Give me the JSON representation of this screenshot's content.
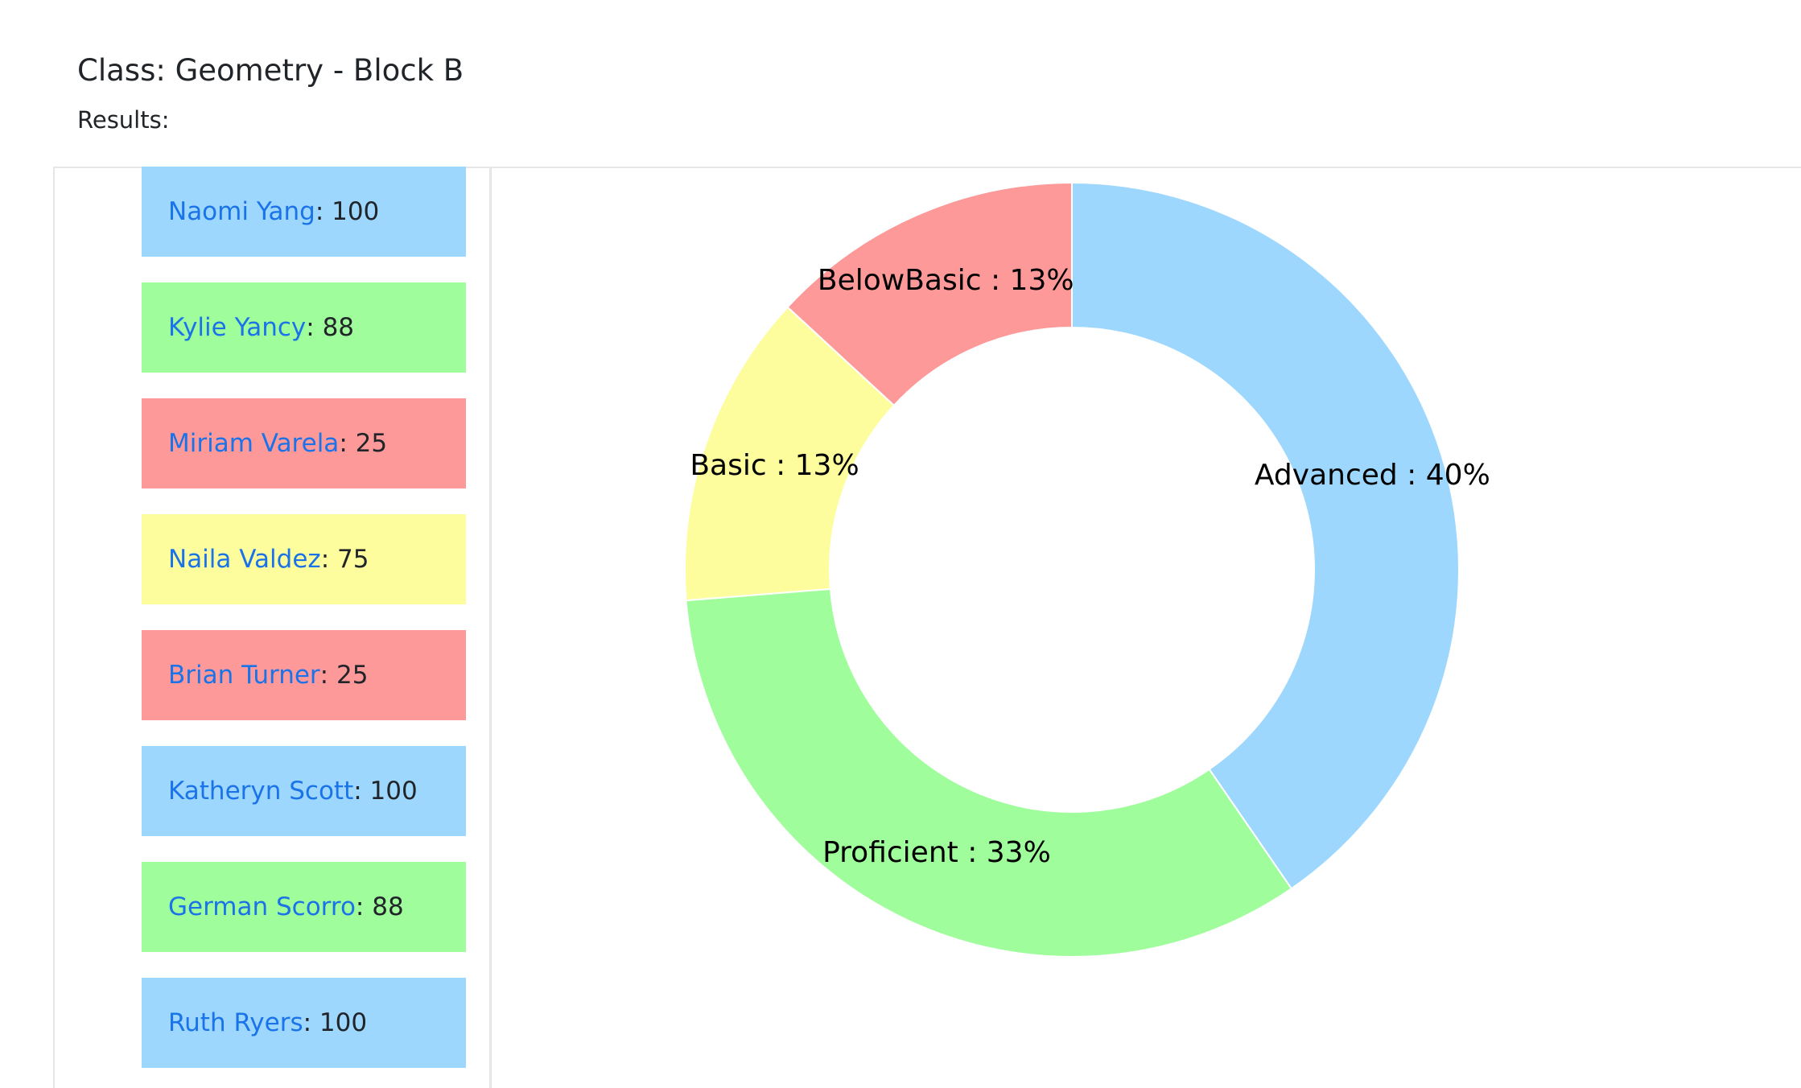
{
  "page": {
    "class_title": "Class: Geometry - Block B",
    "results_label": "Results:"
  },
  "students": [
    {
      "name": "Naomi Yang",
      "score_text": ": 100",
      "level": "Advanced"
    },
    {
      "name": "Kylie Yancy",
      "score_text": ": 88",
      "level": "Proficient"
    },
    {
      "name": "Miriam Varela",
      "score_text": ": 25",
      "level": "BelowBasic"
    },
    {
      "name": "Naila Valdez",
      "score_text": ": 75",
      "level": "Basic"
    },
    {
      "name": "Brian Turner",
      "score_text": ": 25",
      "level": "BelowBasic"
    },
    {
      "name": "Katheryn Scott",
      "score_text": ": 100",
      "level": "Advanced"
    },
    {
      "name": "German Scorro",
      "score_text": ": 88",
      "level": "Proficient"
    },
    {
      "name": "Ruth Ryers",
      "score_text": ": 100",
      "level": "Advanced"
    }
  ],
  "level_colors": {
    "Advanced": "#9dd7fd",
    "Proficient": "#9ffd9b",
    "Basic": "#fdfd9d",
    "BelowBasic": "#fd9999"
  },
  "link_color": "#1a73e8",
  "chart_data": {
    "type": "pie",
    "donut": true,
    "slices": [
      {
        "name": "Advanced",
        "value": 40,
        "label": "Advanced : 40%",
        "color": "#9dd7fd"
      },
      {
        "name": "Proficient",
        "value": 33,
        "label": "Proficient : 33%",
        "color": "#9ffd9b"
      },
      {
        "name": "Basic",
        "value": 13,
        "label": "Basic : 13%",
        "color": "#fdfd9d"
      },
      {
        "name": "BelowBasic",
        "value": 13,
        "label": "BelowBasic : 13%",
        "color": "#fd9999"
      }
    ]
  }
}
